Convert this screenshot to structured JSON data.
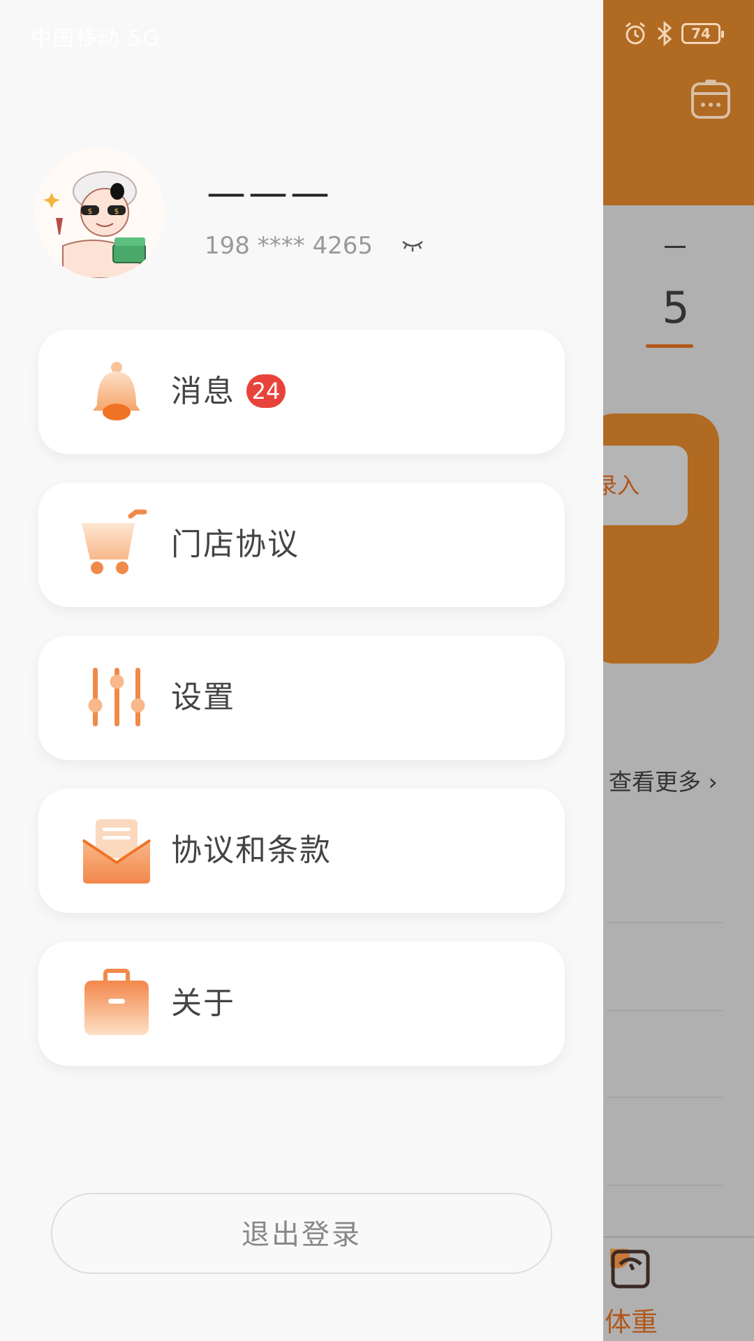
{
  "status_bar": {
    "carrier": "中国移动 5G",
    "battery": "74"
  },
  "background_page": {
    "date_dash": "一",
    "date_number": "5",
    "entry_button": "录入",
    "more_link": "查看更多 ›",
    "bottom_nav_label": "体重",
    "header_color": "#b06a22"
  },
  "profile": {
    "username": "———",
    "phone": "198 **** 4265"
  },
  "menu": [
    {
      "label": "消息",
      "icon": "bell-icon",
      "badge": "24"
    },
    {
      "label": "门店协议",
      "icon": "cart-icon"
    },
    {
      "label": "设置",
      "icon": "sliders-icon"
    },
    {
      "label": "协议和条款",
      "icon": "mail-icon"
    },
    {
      "label": "关于",
      "icon": "briefcase-icon"
    }
  ],
  "logout_label": "退出登录",
  "colors": {
    "accent": "#f08a4b",
    "badge": "#e8433a",
    "drawer_bg": "#f8f8f8"
  }
}
